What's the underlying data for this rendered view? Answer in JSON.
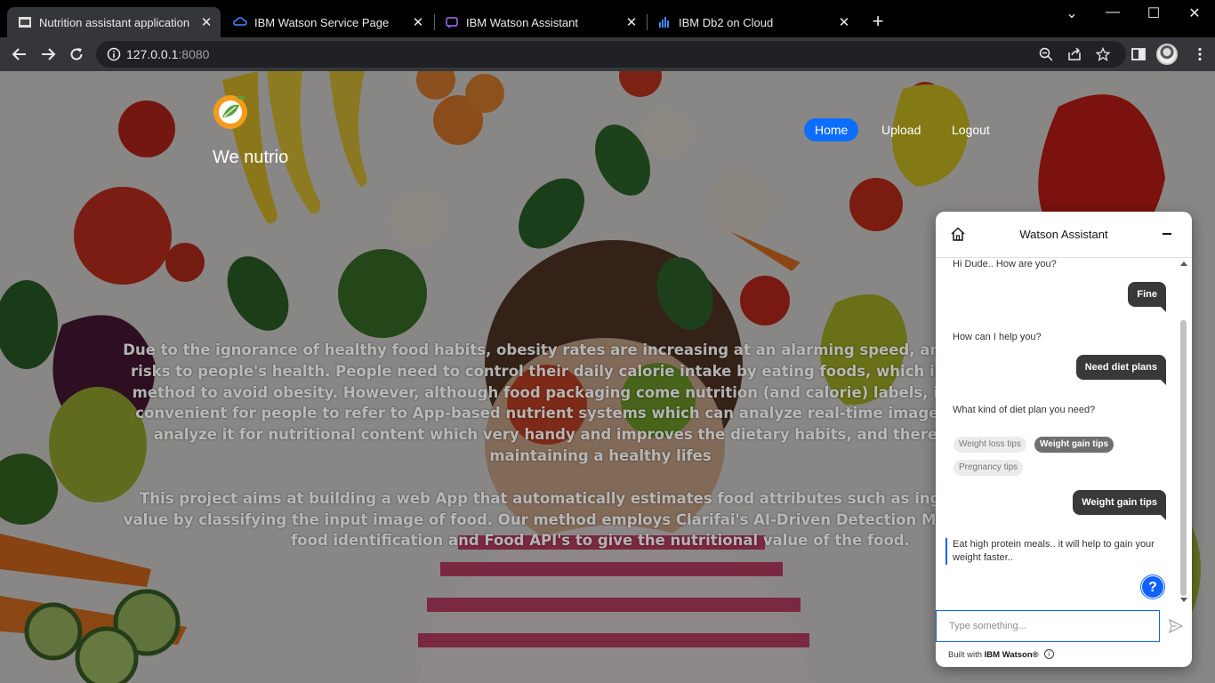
{
  "browser": {
    "tabs": [
      {
        "title": "Nutrition assistant application",
        "favicon": "we-nutrio-favicon"
      },
      {
        "title": "IBM Watson Service Page",
        "favicon": "ibm-cloud-icon"
      },
      {
        "title": "IBM Watson Assistant",
        "favicon": "watson-assistant-icon"
      },
      {
        "title": "IBM Db2 on Cloud",
        "favicon": "db2-icon"
      }
    ],
    "url_host": "127.0.0.1",
    "url_port": ":8080"
  },
  "site": {
    "brand": "We nutrio",
    "nav": [
      {
        "label": "Home",
        "active": true
      },
      {
        "label": "Upload",
        "active": false
      },
      {
        "label": "Logout",
        "active": false
      }
    ],
    "paragraph1": "Due to the ignorance of healthy food habits, obesity rates are increasing at an alarming speed, an reflective of the risks to people's health. People need to control their daily calorie intake by eating foods, which is the most basic method to avoid obesity. However, although food packaging come nutrition (and calorie) labels, it's still not very convenient for people to refer to App-based nutrient systems which can analyze real-time images of a meal and analyze it for nutritional content which very handy and improves the dietary habits, and therefore, helps in maintaining a healthy lifes",
    "paragraph2": "This project aims at building a web App that automatically estimates food attributes such as ingred nutritional value by classifying the input image of food.  Our method employs Clarifai's AI-Driven Detection Model for accurate food identification and Food API's to give the nutritional value of the food."
  },
  "assistant": {
    "title": "Watson Assistant",
    "messages": [
      {
        "from": "bot",
        "text": "Hi Dude.. How are you?"
      },
      {
        "from": "user",
        "text": "Fine"
      },
      {
        "from": "bot",
        "text": "How can I help you?"
      },
      {
        "from": "user",
        "text": "Need diet plans"
      },
      {
        "from": "bot",
        "text": "What kind of diet plan you need?"
      },
      {
        "from": "user",
        "text": "Weight gain tips"
      },
      {
        "from": "bot",
        "text": "Eat high protein meals.. it will help to gain your weight faster.."
      }
    ],
    "options": [
      {
        "label": "Weight loss tips",
        "selected": false
      },
      {
        "label": "Weight gain tips",
        "selected": true
      },
      {
        "label": "Pregnancy tips",
        "selected": false
      }
    ],
    "help_label": "?",
    "input_placeholder": "Type something...",
    "footer_prefix": "Built with ",
    "footer_brand": "IBM Watson®"
  },
  "colors": {
    "nav_active": "#0d6efd",
    "watson_blue": "#0f62fe",
    "user_bubble": "#393939"
  }
}
